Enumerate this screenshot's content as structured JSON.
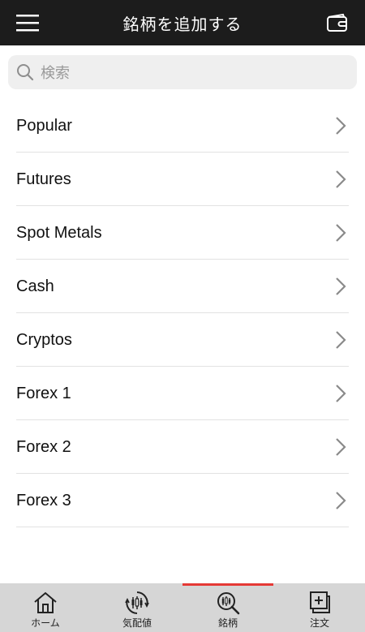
{
  "header": {
    "title": "銘柄を追加する",
    "menu_icon": "hamburger-menu-icon",
    "wallet_icon": "wallet-icon"
  },
  "search": {
    "placeholder": "検索",
    "value": ""
  },
  "categories": [
    {
      "label": "Popular"
    },
    {
      "label": "Futures"
    },
    {
      "label": "Spot Metals"
    },
    {
      "label": "Cash"
    },
    {
      "label": "Cryptos"
    },
    {
      "label": "Forex 1"
    },
    {
      "label": "Forex 2"
    },
    {
      "label": "Forex 3"
    }
  ],
  "tabbar": {
    "active_color": "#e53935",
    "tabs": [
      {
        "label": "ホーム",
        "icon": "home-icon",
        "active": false
      },
      {
        "label": "気配値",
        "icon": "quotes-icon",
        "active": false
      },
      {
        "label": "銘柄",
        "icon": "symbol-search-icon",
        "active": true
      },
      {
        "label": "注文",
        "icon": "order-icon",
        "active": false
      }
    ]
  }
}
